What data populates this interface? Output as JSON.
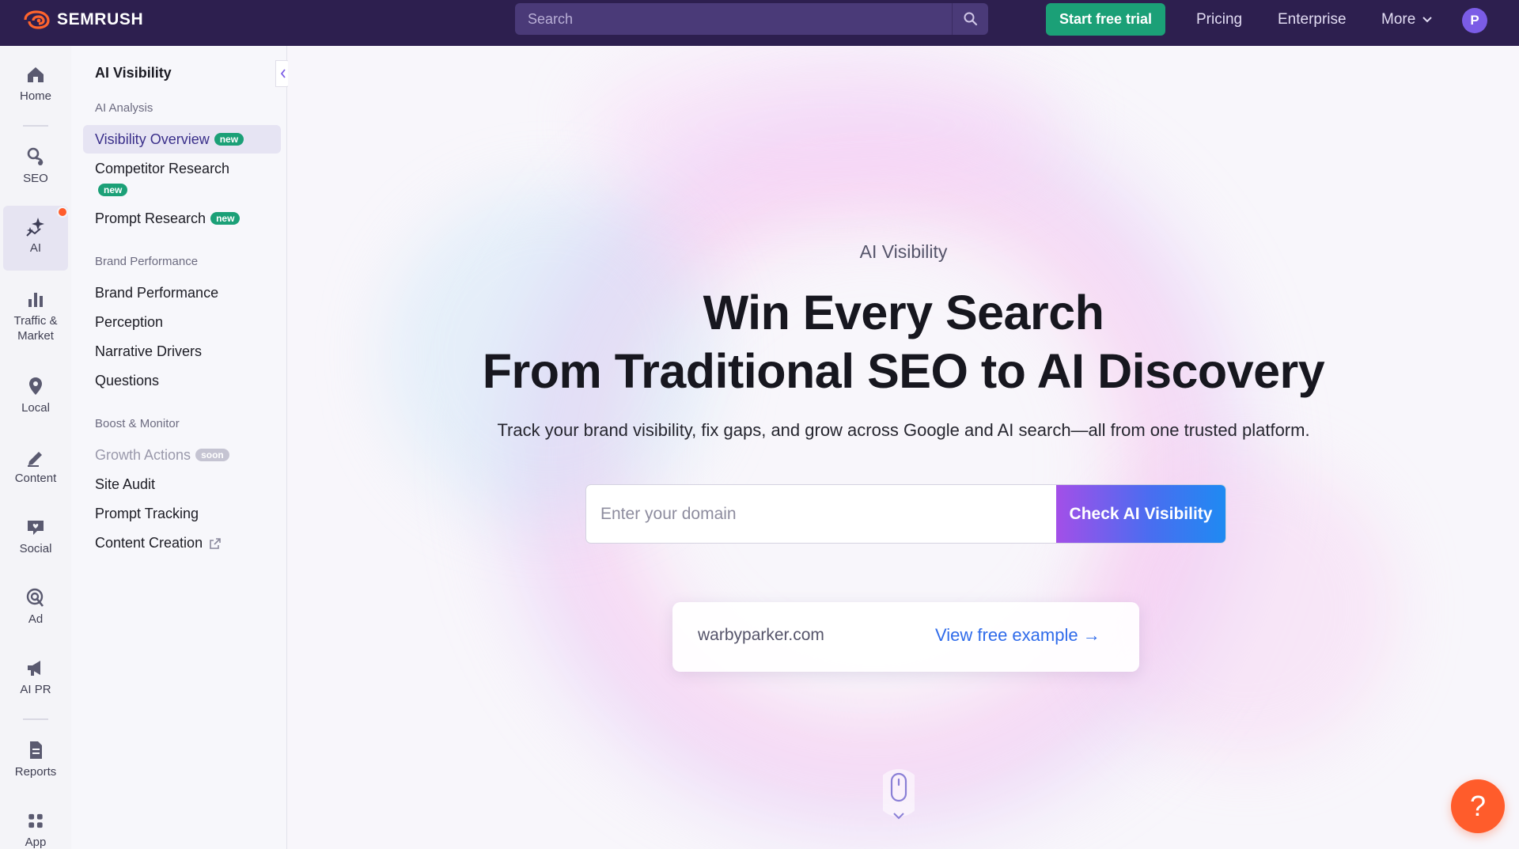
{
  "brand": {
    "name": "SEMRUSH"
  },
  "topbar": {
    "search_placeholder": "Search",
    "trial_label": "Start free trial",
    "links": [
      "Pricing",
      "Enterprise",
      "More"
    ],
    "avatar_initial": "P"
  },
  "rail": {
    "items": [
      {
        "label": "Home",
        "icon": "home-icon"
      },
      {
        "label": "SEO",
        "icon": "seo-icon"
      },
      {
        "label": "AI",
        "icon": "ai-sparkle-icon",
        "active": true,
        "has_notification": true
      },
      {
        "label": "Traffic & Market",
        "icon": "bar-chart-icon"
      },
      {
        "label": "Local",
        "icon": "map-pin-icon"
      },
      {
        "label": "Content",
        "icon": "pen-icon"
      },
      {
        "label": "Social",
        "icon": "heart-chat-icon"
      },
      {
        "label": "Ad",
        "icon": "ad-target-icon"
      },
      {
        "label": "AI PR",
        "icon": "megaphone-icon"
      },
      {
        "label": "Reports",
        "icon": "document-icon"
      },
      {
        "label": "App",
        "icon": "apps-grid-icon"
      }
    ]
  },
  "subnav": {
    "title": "AI Visibility",
    "groups": [
      {
        "label": "AI Analysis",
        "items": [
          {
            "label": "Visibility Overview",
            "badge": "new",
            "active": true
          },
          {
            "label": "Competitor Research",
            "badge": "new"
          },
          {
            "label": "Prompt Research",
            "badge": "new"
          }
        ]
      },
      {
        "label": "Brand Performance",
        "items": [
          {
            "label": "Brand Performance"
          },
          {
            "label": "Perception"
          },
          {
            "label": "Narrative Drivers"
          },
          {
            "label": "Questions"
          }
        ]
      },
      {
        "label": "Boost & Monitor",
        "items": [
          {
            "label": "Growth Actions",
            "badge": "soon",
            "disabled": true
          },
          {
            "label": "Site Audit"
          },
          {
            "label": "Prompt Tracking"
          },
          {
            "label": "Content Creation",
            "external": true
          }
        ]
      }
    ]
  },
  "hero": {
    "eyebrow": "AI Visibility",
    "headline_line1": "Win Every Search",
    "headline_line2": "From Traditional SEO to AI Discovery",
    "subline": "Track your brand visibility, fix gaps, and grow across Google and AI search—all from one trusted platform.",
    "domain_placeholder": "Enter your domain",
    "cta_label": "Check AI Visibility",
    "example_domain": "warbyparker.com",
    "example_link": "View free example →"
  },
  "help": {
    "label": "?"
  },
  "colors": {
    "topbar_bg": "#2d1f4f",
    "trial_green": "#1ba077",
    "badge_green": "#1ba077",
    "help_orange": "#ff5c2b",
    "link_blue": "#2f6bea",
    "cta_gradient_start": "#a34fe8",
    "cta_gradient_end": "#1f8af2"
  }
}
